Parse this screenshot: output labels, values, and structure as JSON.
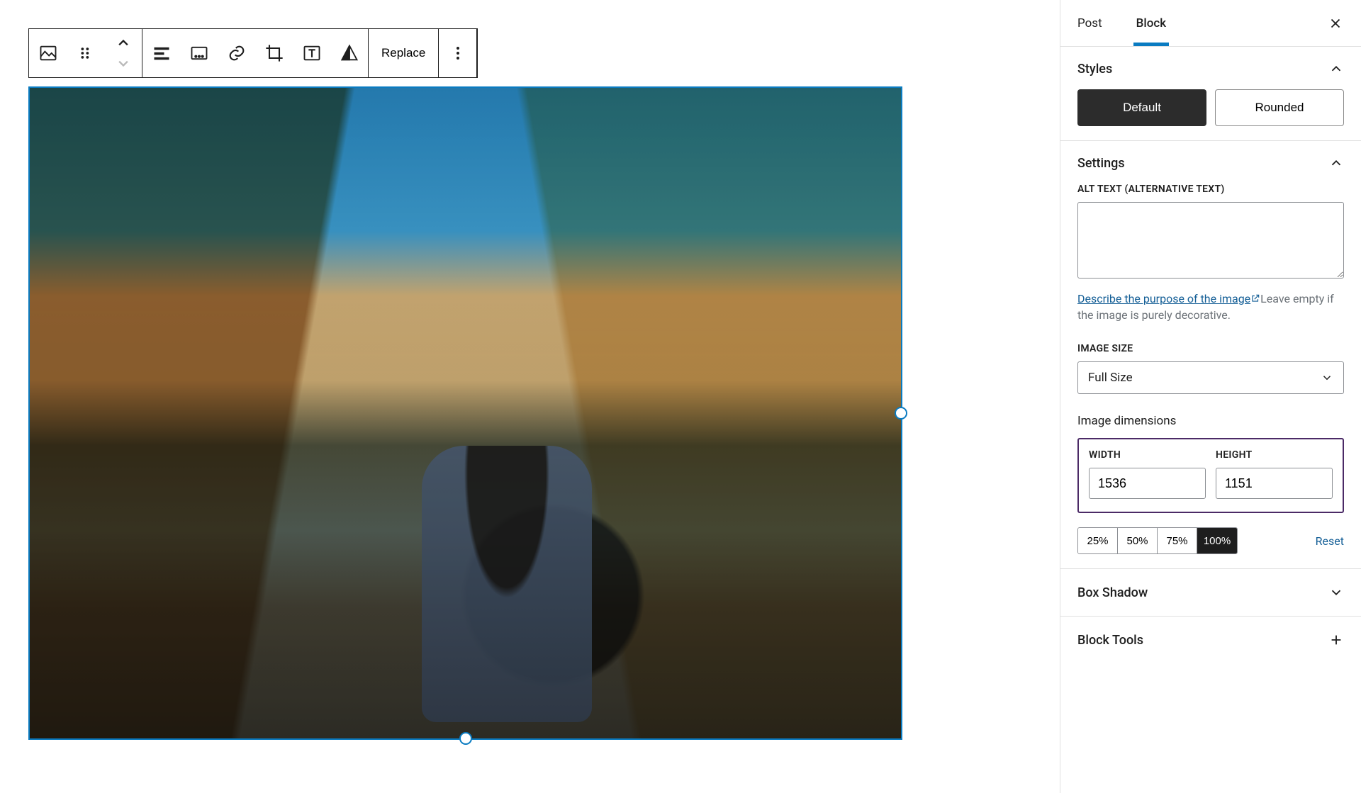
{
  "toolbar": {
    "replace_label": "Replace"
  },
  "sidebar": {
    "tabs": {
      "post": "Post",
      "block": "Block"
    },
    "styles": {
      "title": "Styles",
      "default": "Default",
      "rounded": "Rounded"
    },
    "settings": {
      "title": "Settings",
      "alt_label": "ALT TEXT (ALTERNATIVE TEXT)",
      "alt_value": "",
      "describe_link": "Describe the purpose of the image",
      "describe_tail": "Leave empty if the image is purely decorative.",
      "image_size_label": "IMAGE SIZE",
      "image_size_value": "Full Size",
      "dimensions_label": "Image dimensions",
      "width_label": "WIDTH",
      "height_label": "HEIGHT",
      "width_value": "1536",
      "height_value": "1151",
      "scale_25": "25%",
      "scale_50": "50%",
      "scale_75": "75%",
      "scale_100": "100%",
      "reset": "Reset"
    },
    "box_shadow": "Box Shadow",
    "block_tools": "Block Tools"
  }
}
